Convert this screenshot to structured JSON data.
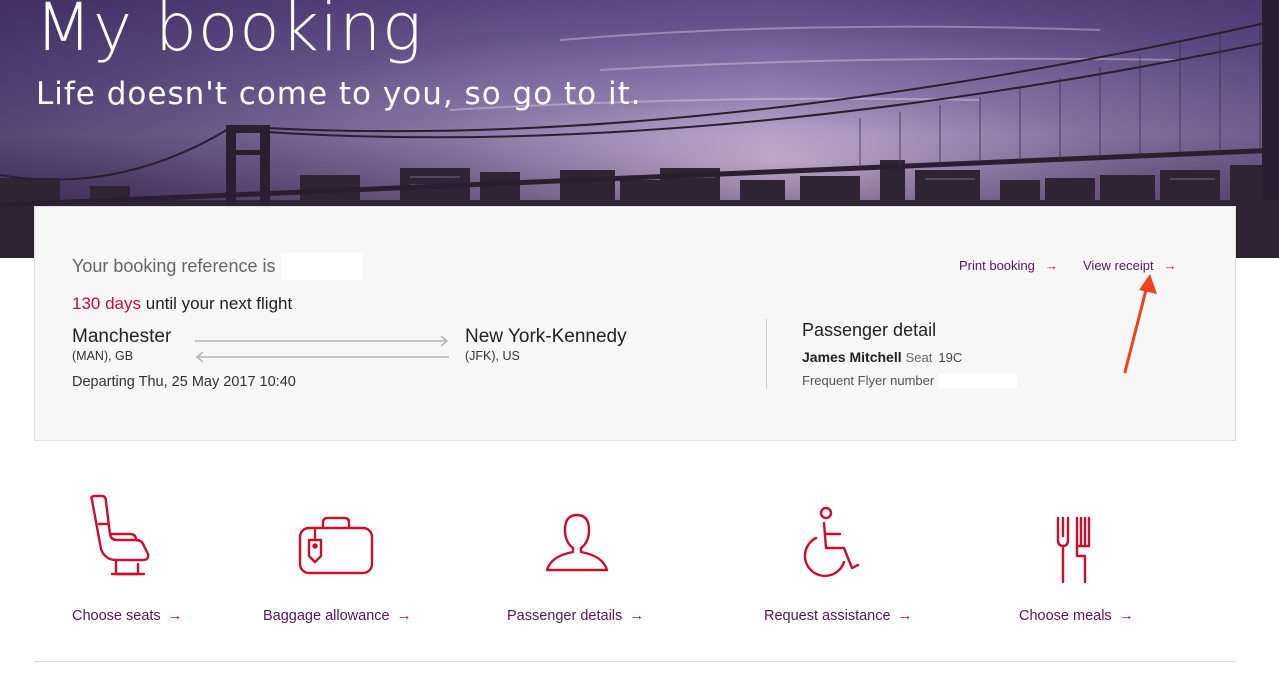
{
  "hero": {
    "title": "My booking",
    "subtitle": "Life doesn't come to you, so go to it."
  },
  "booking": {
    "reference_label": "Your booking reference is",
    "reference_value": "",
    "countdown_days": "130 days",
    "countdown_text": "until your next flight",
    "origin": {
      "city": "Manchester",
      "code": "(MAN), GB"
    },
    "destination": {
      "city": "New York-Kennedy",
      "code": "(JFK), US"
    },
    "departing": "Departing Thu, 25 May 2017 10:40",
    "links": {
      "print_booking": "Print booking",
      "view_receipt": "View receipt"
    }
  },
  "passenger": {
    "heading": "Passenger detail",
    "name": "James Mitchell",
    "seat_label": "Seat",
    "seat_value": "19C",
    "frequent_flyer_label": "Frequent Flyer number",
    "frequent_flyer_value": ""
  },
  "actions": [
    {
      "label": "Choose seats",
      "icon": "seat-icon"
    },
    {
      "label": "Baggage allowance",
      "icon": "baggage-icon"
    },
    {
      "label": "Passenger details",
      "icon": "person-icon"
    },
    {
      "label": "Request assistance",
      "icon": "wheelchair-icon"
    },
    {
      "label": "Choose meals",
      "icon": "meal-icon"
    }
  ],
  "colors": {
    "brand_purple": "#5a1459",
    "accent_red": "#c8102e",
    "annotation_red": "#f0421c"
  }
}
